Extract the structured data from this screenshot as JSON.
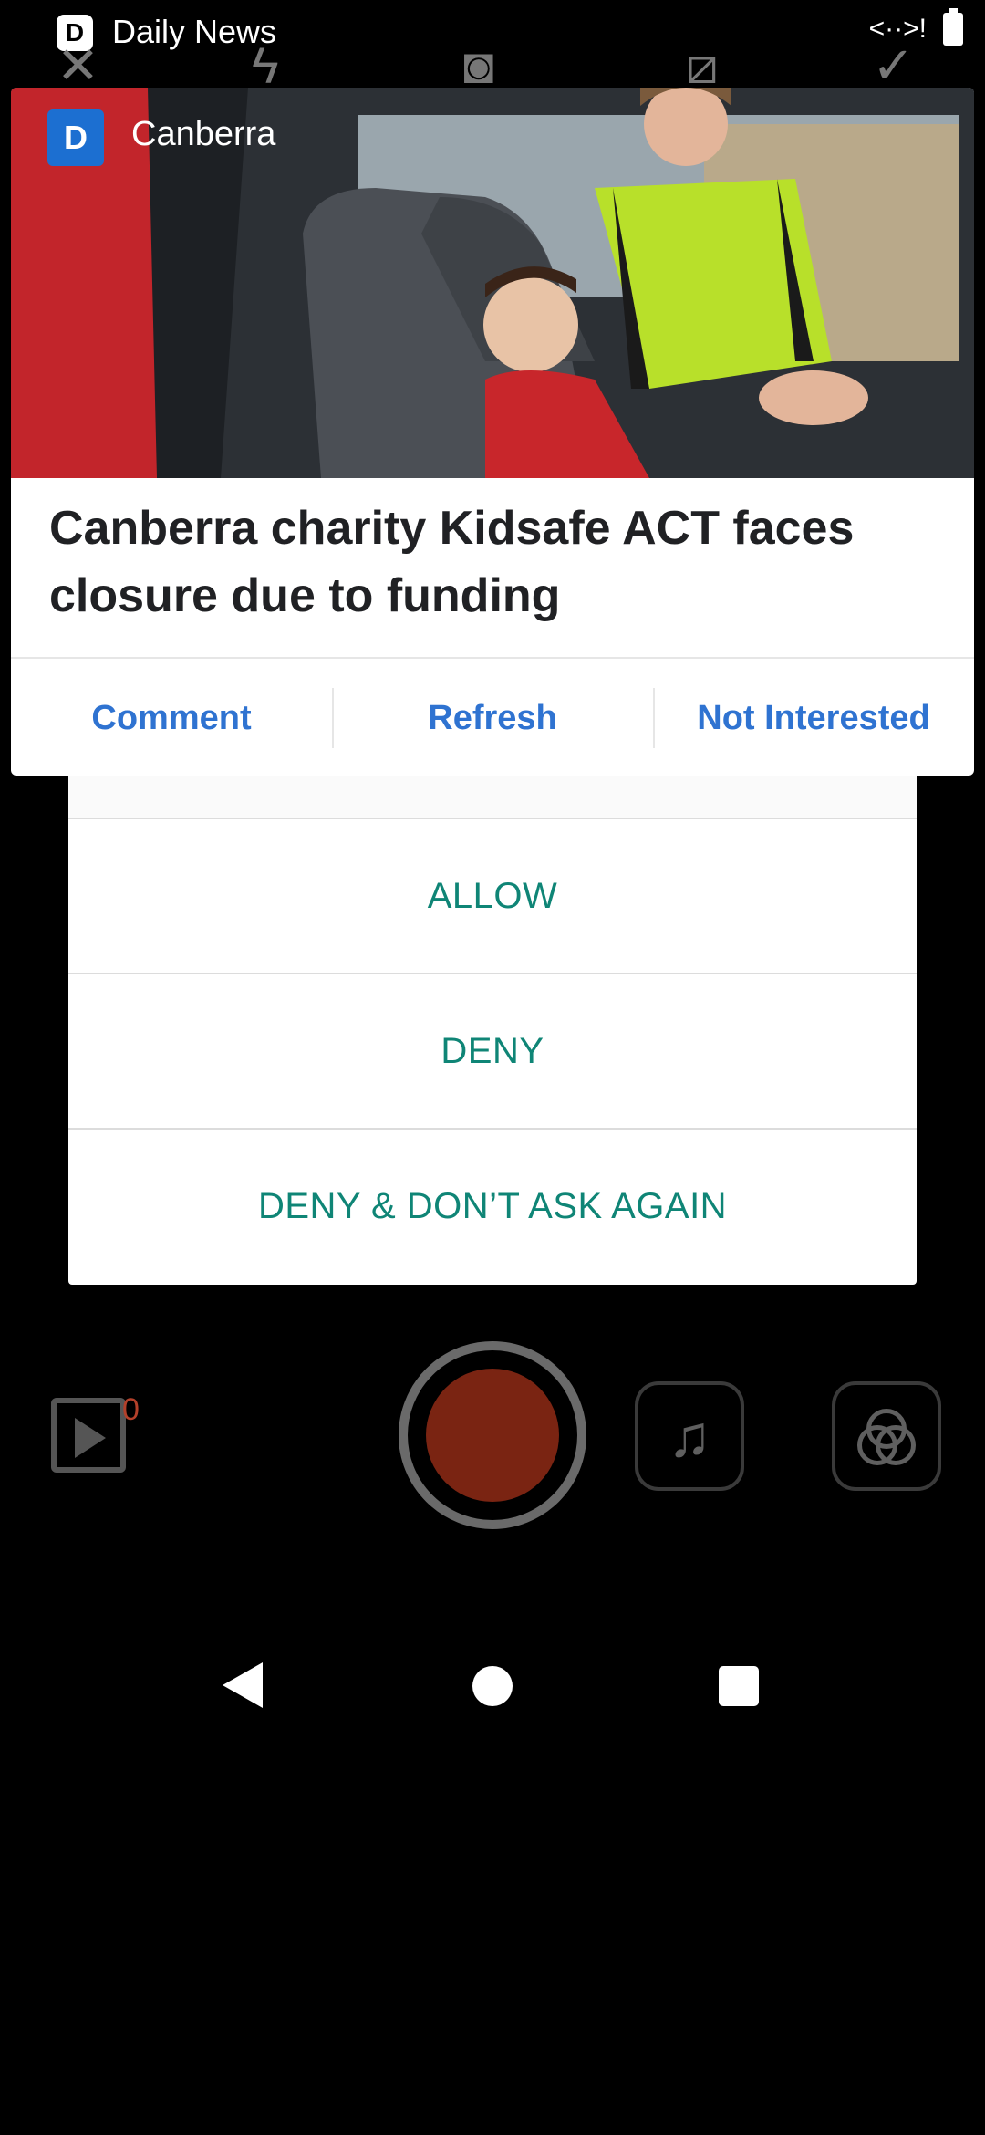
{
  "status_bar": {
    "app_icon_letter": "D",
    "app_title": "Daily News",
    "signal_glyph": "<··>!"
  },
  "camera_top": {
    "icons": [
      "close-icon",
      "flash-icon",
      "camera-icon",
      "flash-off-icon",
      "check-icon"
    ]
  },
  "notification": {
    "source_logo_letter": "D",
    "source_label": "Canberra",
    "headline": "Canberra charity Kidsafe ACT faces closure due to funding",
    "actions": [
      "Comment",
      "Refresh",
      "Not Interested"
    ],
    "link_color": "#2f73d1"
  },
  "permission_dialog": {
    "buttons": [
      "ALLOW",
      "DENY",
      "DENY & DON’T ASK AGAIN"
    ],
    "button_color": "#0f8576"
  },
  "camera_bottom": {
    "gallery_count": "0",
    "music_icon": "music-note-icon",
    "effects_icon": "effects-circles-icon",
    "record_color": "#7a2412"
  },
  "nav_bar": {
    "icons": [
      "back-icon",
      "home-icon",
      "recents-icon"
    ]
  }
}
